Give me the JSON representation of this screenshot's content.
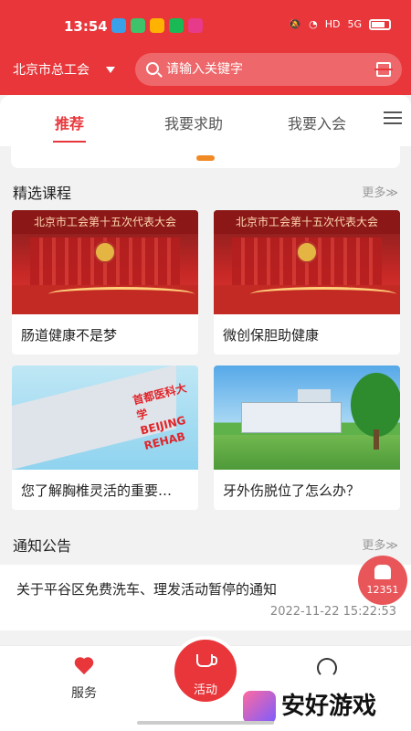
{
  "status_bar": {
    "time": "13:54",
    "network": "5G",
    "hd": "HD"
  },
  "header": {
    "location": "北京市总工会",
    "search_placeholder": "请输入关键字"
  },
  "tabs": [
    {
      "label": "推荐",
      "active": true
    },
    {
      "label": "我要求助",
      "active": false
    },
    {
      "label": "我要入会",
      "active": false
    }
  ],
  "courses": {
    "title": "精选课程",
    "more": "更多≫",
    "items": [
      {
        "label": "肠道健康不是梦",
        "thumb_text": "北京市工会第十五次代表大会"
      },
      {
        "label": "微创保胆助健康",
        "thumb_text": "北京市工会第十五次代表大会"
      },
      {
        "label": "您了解胸椎灵活的重要…",
        "thumb_text": "首都医科大学 BEIJING REHAB"
      },
      {
        "label": "牙外伤脱位了怎么办？",
        "thumb_text": ""
      }
    ]
  },
  "notices": {
    "title": "通知公告",
    "more": "更多≫",
    "items": [
      {
        "title": "关于平谷区免费洗车、理发活动暂停的通知",
        "time": "2022-11-22 15:22:53"
      }
    ]
  },
  "hotline": {
    "number": "12351"
  },
  "bottom_nav": {
    "service": "服务",
    "activity": "活动"
  },
  "watermark": {
    "text": "安好游戏"
  },
  "colors": {
    "brand": "#e8363a",
    "accent_dot": "#f08a24"
  }
}
